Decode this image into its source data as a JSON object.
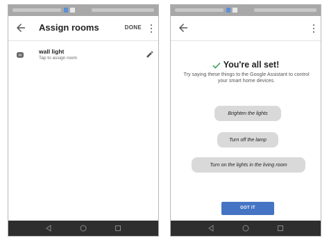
{
  "colors": {
    "accent": "#4574c4",
    "status_bar": "#a8a8a8",
    "nav_bar": "#2e2e2e",
    "chip": "#d9d9d9",
    "check": "#3aa056"
  },
  "left_screen": {
    "app_bar": {
      "title": "Assign rooms",
      "done_label": "DONE",
      "back_icon": "arrow-left-icon",
      "menu_icon": "more-vert-icon"
    },
    "devices": [
      {
        "name": "wall light",
        "subtitle": "Tap to assign room",
        "icon": "light-device-icon",
        "action_icon": "pencil-edit-icon"
      }
    ]
  },
  "right_screen": {
    "app_bar": {
      "back_icon": "arrow-left-icon",
      "menu_icon": "more-vert-icon"
    },
    "success": {
      "title": "You're all set!",
      "icon": "checkmark-icon",
      "description": "Try saying these things to the Google Assistant to control your smart home devices."
    },
    "suggestions": [
      "Brighten the lights",
      "Turn off the lamp",
      "Turn on the lights in the living room"
    ],
    "primary_button": "GOT IT"
  }
}
